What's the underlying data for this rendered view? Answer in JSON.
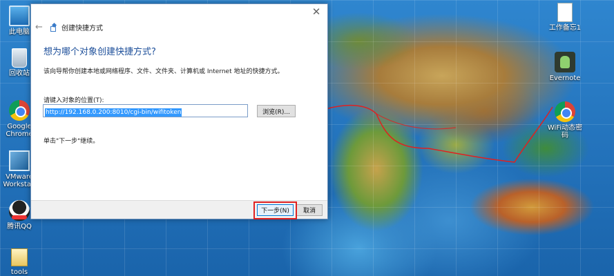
{
  "desktop": {
    "icons": [
      {
        "label": "此电脑"
      },
      {
        "label": "回收站"
      },
      {
        "label": "Google Chrome"
      },
      {
        "label": "VMware Workstati"
      },
      {
        "label": "腾讯QQ"
      },
      {
        "label": "tools"
      },
      {
        "label": "工作备忘1"
      },
      {
        "label": "Evernote"
      },
      {
        "label": "WiFi动态密码"
      }
    ]
  },
  "dialog": {
    "close_glyph": "✕",
    "back_glyph": "←",
    "title": "创建快捷方式",
    "heading": "想为哪个对象创建快捷方式?",
    "description": "该向导帮你创建本地或网络程序、文件、文件夹、计算机或 Internet 地址的快捷方式。",
    "location_label": "请键入对象的位置(T):",
    "location_value": "http://192.168.0.200:8010/cgi-bin/wifitoken",
    "browse_label": "浏览(R)...",
    "continue_text": "单击\"下一步\"继续。",
    "next_label": "下一步(N)",
    "cancel_label": "取消"
  },
  "colors": {
    "heading": "#1d4f9a",
    "annotation": "#e02020",
    "selection": "#3399ff"
  }
}
